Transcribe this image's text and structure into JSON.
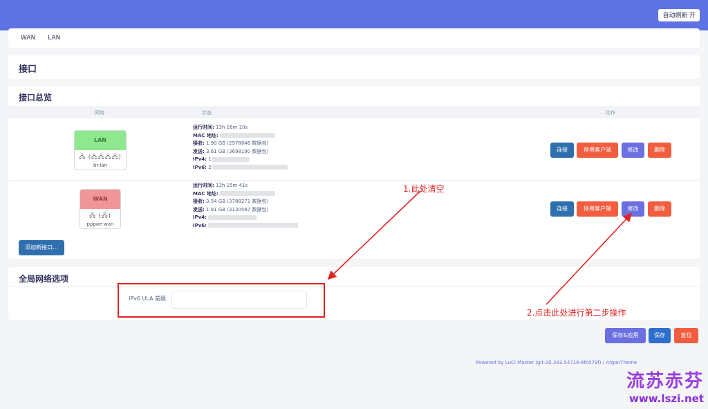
{
  "header": {
    "refresh_label": "自动刷新 开"
  },
  "tabs": [
    {
      "label": "WAN"
    },
    {
      "label": "LAN"
    }
  ],
  "page_title": "接口",
  "overview": {
    "title": "接口总览",
    "columns": {
      "network": "网络",
      "status": "状态",
      "actions": "动作"
    },
    "interfaces": [
      {
        "name": "LAN",
        "device": "br-lan",
        "icons": "🖧 (🖧🖧🖧🖧)",
        "header_color": "#8ee88e",
        "status": {
          "uptime_label": "运行时间:",
          "uptime": "13h 16m 10s",
          "mac_label": "MAC 地址:",
          "mac": "",
          "rx_label": "接收:",
          "rx": "1.90 GB (2978846 数据包)",
          "tx_label": "发送:",
          "tx": "3.61 GB (3698190 数据包)",
          "ipv4_label": "IPv4:",
          "ipv4": "1",
          "ipv6_label": "IPv6:",
          "ipv6": "2"
        }
      },
      {
        "name": "WAN",
        "device": "pppoe-wan",
        "icons": "🖧 (🖧)",
        "header_color": "#f0969a",
        "status": {
          "uptime_label": "运行时间:",
          "uptime": "13h 15m 41s",
          "mac_label": "MAC 地址:",
          "mac": "",
          "rx_label": "接收:",
          "rx": "3.54 GB (3788271 数据包)",
          "tx_label": "发送:",
          "tx": "1.91 GB (3130567 数据包)",
          "ipv4_label": "IPv4:",
          "ipv4": "",
          "ipv6_label": "IPv6:",
          "ipv6": ""
        }
      }
    ],
    "actions": {
      "connect": "连接",
      "stop": "停用客户端",
      "edit": "修改",
      "delete": "删除"
    },
    "add_label": "添加新接口..."
  },
  "global": {
    "title": "全局网络选项",
    "ula_label": "IPv6 ULA 前缀",
    "ula_value": ""
  },
  "buttons": {
    "save_apply": "保存&应用",
    "save": "保存",
    "reset": "复位"
  },
  "footer": "Powered by LuCI Master (git-20.343.54716-6fc079f) / ArgonTheme",
  "annotations": {
    "step1": "1.此处清空",
    "step2": "2.点击此处进行第二步操作"
  },
  "watermark": {
    "name": "流苏赤芬",
    "url": "www.lszi.net"
  }
}
